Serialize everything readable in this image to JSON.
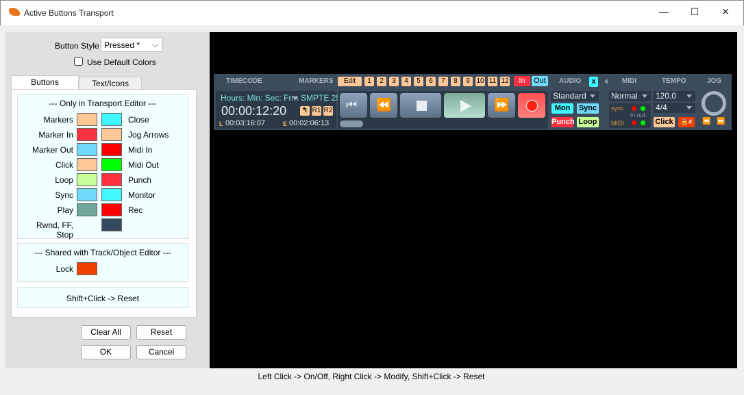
{
  "window": {
    "title": "Active Buttons Transport",
    "minimize": "—",
    "maximize": "☐",
    "close": "✕"
  },
  "left": {
    "button_style_label": "Button Style",
    "button_style_value": "Pressed *",
    "use_default_colors": "Use Default Colors",
    "use_default_checked": false,
    "tabs": [
      "Buttons",
      "Text/Icons"
    ],
    "section1_title": "---  Only in Transport Editor  ---",
    "rows": [
      {
        "left": "Markers",
        "lc": "#ffc896",
        "rc": "#40f8ff",
        "right": "Close"
      },
      {
        "left": "Marker In",
        "lc": "#ff3040",
        "rc": "#ffc896",
        "right": "Jog Arrows"
      },
      {
        "left": "Marker Out",
        "lc": "#70d8f8",
        "rc": "#ff0000",
        "right": "Midi In"
      },
      {
        "left": "Click",
        "lc": "#ffc896",
        "rc": "#00ff00",
        "right": "Midi Out"
      },
      {
        "left": "Loop",
        "lc": "#c8ff96",
        "rc": "#ff3040",
        "right": "Punch"
      },
      {
        "left": "Sync",
        "lc": "#70d8f8",
        "rc": "#40f8ff",
        "right": "Monitor"
      },
      {
        "left": "Play",
        "lc": "#6fa89a",
        "rc": "#ff0000",
        "right": "Rec"
      },
      {
        "left": "Rwnd, FF, Stop",
        "lc": "",
        "rc": "#344a5c",
        "right": ""
      }
    ],
    "section2_title": "---  Shared with Track/Object Editor  ---",
    "lock_label": "Lock",
    "lock_color": "#f04000",
    "reset_hint": "Shift+Click -> Reset",
    "clear_all": "Clear All",
    "reset": "Reset",
    "ok": "OK",
    "cancel": "Cancel"
  },
  "status": "Left Click -> On/Off, Right Click -> Modify, Shift+Click -> Reset",
  "transport": {
    "headers": {
      "timecode": "TIMECODE",
      "markers": "MARKERS",
      "audio": "AUDIO",
      "midi": "MIDI",
      "tempo": "TEMPO",
      "jog": "JOG"
    },
    "edit": "Edit",
    "markers": [
      "1",
      "2",
      "3",
      "4",
      "5",
      "6",
      "7",
      "8",
      "9",
      "10",
      "11",
      "12"
    ],
    "in": "In",
    "out": "Out",
    "audio_close": "x",
    "time_format": "Hours: Min: Sec: Frm",
    "smpte": "SMPTE 25",
    "time": "00:00:12:20",
    "r1": "R1",
    "r2": "R2",
    "left_label": "L",
    "left_time": "00:03:16:07",
    "end_label": "E",
    "end_time": "00:02:06:13",
    "audio_mode": "Standard",
    "mon": "Mon",
    "sync": "Sync",
    "punch": "Punch",
    "loop": "Loop",
    "midi_mode": "Normal",
    "sync_label": "sync",
    "in_out": "in out",
    "midi_label": "MIDI",
    "tempo": "120.0",
    "signature": "4/4",
    "click": "Click",
    "lock": "🔒#"
  }
}
